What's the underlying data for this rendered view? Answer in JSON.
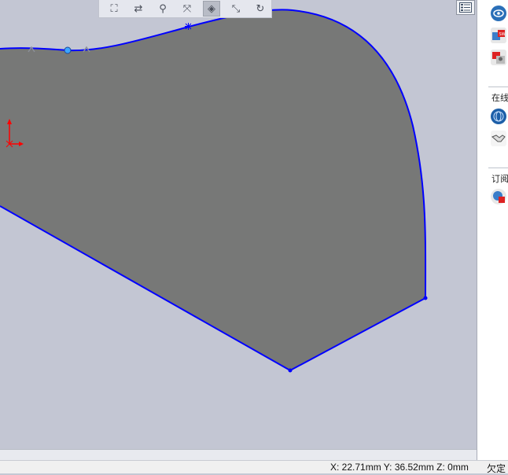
{
  "toolbar": {
    "buttons": [
      {
        "name": "zoom-to-fit-icon",
        "glyph": "⛶"
      },
      {
        "name": "zoom-to-area-icon",
        "glyph": "⇄"
      },
      {
        "name": "zoom-in-out-icon",
        "glyph": "⚲"
      },
      {
        "name": "rotate-view-icon",
        "glyph": "⤧"
      },
      {
        "name": "section-view-icon",
        "glyph": "◈"
      },
      {
        "name": "view-orientation-icon",
        "glyph": "⤡"
      },
      {
        "name": "pan-icon",
        "glyph": "↻"
      }
    ]
  },
  "task_pane": {
    "icons_top": [
      "solidworks-resources-icon",
      "design-library-icon",
      "file-explorer-icon"
    ],
    "section_online": "在线",
    "icons_online": [
      "online-globe-icon",
      "handshake-icon"
    ],
    "section_subscribe": "订阅",
    "icons_subscribe": [
      "subscription-services-icon"
    ]
  },
  "status": {
    "coordinates": "X: 22.71mm Y: 36.52mm Z: 0mm",
    "state": "欠定"
  },
  "colors": {
    "viewport_bg": "#c3c6d3",
    "sketch_fill": "#777877",
    "sketch_line": "#0000ff",
    "origin_axis": "#ff0000"
  }
}
